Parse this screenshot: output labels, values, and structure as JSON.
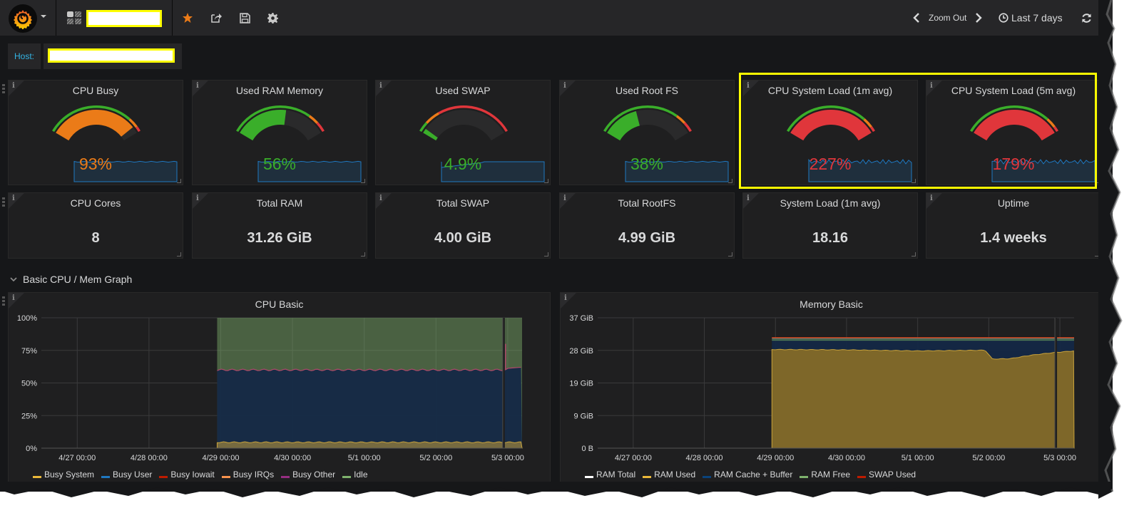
{
  "topnav": {
    "dashboard_title": "",
    "zoom_out_label": "Zoom Out",
    "time_range_label": "Last 7 days",
    "icons": [
      "grafana-logo-icon",
      "dashboards-icon",
      "star-icon",
      "share-icon",
      "save-icon",
      "settings-icon",
      "chevron-left-icon",
      "chevron-right-icon",
      "clock-icon",
      "refresh-icon"
    ],
    "colors": {
      "star": "#eb7b18"
    }
  },
  "variables": {
    "host_label": "Host:",
    "host_value": ""
  },
  "gauges": [
    {
      "title": "CPU Busy",
      "value_text": "93%",
      "value": 93,
      "max": 100,
      "color": "#eb7b18",
      "thresholds": [
        85,
        95
      ]
    },
    {
      "title": "Used RAM Memory",
      "value_text": "56%",
      "value": 56,
      "max": 100,
      "color": "#3aae2a",
      "thresholds": [
        80,
        90
      ]
    },
    {
      "title": "Used SWAP",
      "value_text": "4.9%",
      "value": 4.9,
      "max": 100,
      "color": "#3aae2a",
      "thresholds": [
        10,
        25
      ]
    },
    {
      "title": "Used Root FS",
      "value_text": "38%",
      "value": 38,
      "max": 100,
      "color": "#3aae2a",
      "thresholds": [
        80,
        90
      ]
    },
    {
      "title": "CPU System Load (1m avg)",
      "value_text": "227%",
      "value": 227,
      "max": 100,
      "color": "#e0363b",
      "thresholds": [
        85,
        95
      ]
    },
    {
      "title": "CPU System Load (5m avg)",
      "value_text": "179%",
      "value": 179,
      "max": 100,
      "color": "#e0363b",
      "thresholds": [
        85,
        95
      ]
    }
  ],
  "stats": [
    {
      "title": "CPU Cores",
      "value": "8"
    },
    {
      "title": "Total RAM",
      "value": "31.26 GiB"
    },
    {
      "title": "Total SWAP",
      "value": "4.00 GiB"
    },
    {
      "title": "Total RootFS",
      "value": "4.99 GiB"
    },
    {
      "title": "System Load (1m avg)",
      "value": "18.16"
    },
    {
      "title": "Uptime",
      "value": "1.4 weeks"
    }
  ],
  "row": {
    "title": "Basic CPU / Mem Graph"
  },
  "chart_data": [
    {
      "type": "area",
      "title": "CPU Basic",
      "x_ticks": [
        "4/27 00:00",
        "4/28 00:00",
        "4/29 00:00",
        "4/30 00:00",
        "5/1 00:00",
        "5/2 00:00",
        "5/3 00:00"
      ],
      "y_ticks": [
        "0%",
        "25%",
        "50%",
        "75%",
        "100%"
      ],
      "ylim": [
        0,
        100
      ],
      "xlim_days": [
        -0.5,
        6.2
      ],
      "data_start_day": 1.95,
      "gap_day": 5.93,
      "grid": true,
      "legend_position": "bottom-left",
      "stacked": true,
      "series": [
        {
          "name": "Busy System",
          "color": "#eab839",
          "value": 5
        },
        {
          "name": "Busy User",
          "color": "#1f78c1",
          "value": 55
        },
        {
          "name": "Busy Iowait",
          "color": "#bf1b00",
          "value": 0.3
        },
        {
          "name": "Busy IRQs",
          "color": "#f9934e",
          "value": 0.1
        },
        {
          "name": "Busy Other",
          "color": "#962d82",
          "value": 0.1
        },
        {
          "name": "Idle",
          "color": "#7eb26d",
          "value": 39.5
        }
      ]
    },
    {
      "type": "area",
      "title": "Memory Basic",
      "x_ticks": [
        "4/27 00:00",
        "4/28 00:00",
        "4/29 00:00",
        "4/30 00:00",
        "5/1 00:00",
        "5/2 00:00",
        "5/3 00:00"
      ],
      "y_ticks": [
        "0 B",
        "9 GiB",
        "19 GiB",
        "28 GiB",
        "37 GiB"
      ],
      "ylim": [
        0,
        37
      ],
      "xlim_days": [
        -0.5,
        6.2
      ],
      "data_start_day": 1.95,
      "gap_day": 5.93,
      "grid": true,
      "legend_position": "bottom-left",
      "stacked": true,
      "series": [
        {
          "name": "RAM Total",
          "color": "#ffffff",
          "value": 31.26
        },
        {
          "name": "RAM Used",
          "color": "#eab839",
          "points": [
            [
              1.95,
              28.0
            ],
            [
              3,
              27.9
            ],
            [
              4,
              27.6
            ],
            [
              4.95,
              27.8
            ],
            [
              5.05,
              25.3
            ],
            [
              5.3,
              25.4
            ],
            [
              5.6,
              26.4
            ],
            [
              5.9,
              27.1
            ],
            [
              6.2,
              27.6
            ]
          ]
        },
        {
          "name": "RAM Cache + Buffer",
          "color": "#0a437c",
          "value_top": 30.6
        },
        {
          "name": "RAM Free",
          "color": "#7eb26d",
          "value_top": 31.2
        },
        {
          "name": "SWAP Used",
          "color": "#bf1b00",
          "value": 0.2
        }
      ]
    }
  ]
}
